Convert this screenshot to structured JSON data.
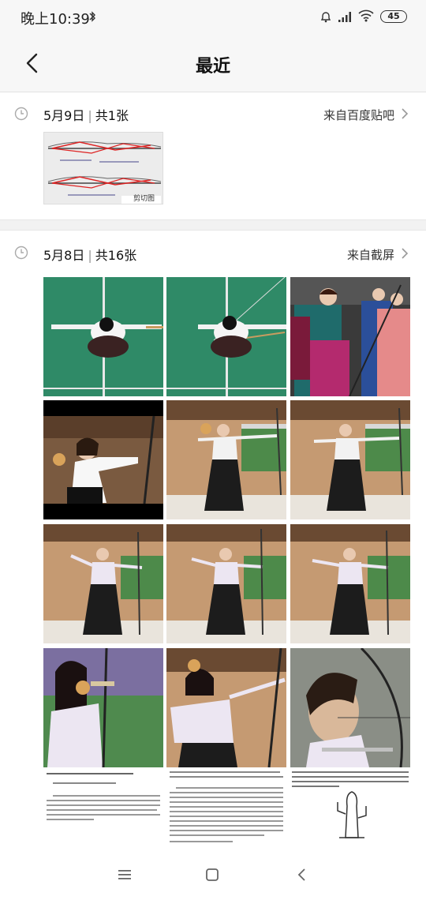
{
  "status_bar": {
    "time": "晚上10:39",
    "battery": "45",
    "icons": [
      "bluetooth-icon",
      "bell-icon",
      "signal-icon",
      "wifi-icon",
      "battery-icon"
    ]
  },
  "header": {
    "title": "最近"
  },
  "sections": [
    {
      "date": "5月9日",
      "count": "共1张",
      "source": "来自百度贴吧",
      "thumb_label": "剪切图"
    },
    {
      "date": "5月8日",
      "count": "共16张",
      "source": "来自截屏"
    }
  ],
  "nav_bar": {
    "icons": [
      "menu-icon",
      "home-icon",
      "back-nav-icon"
    ]
  },
  "colors": {
    "court_green": "#2f8a67",
    "hakama_black": "#1c1c1c",
    "wood": "#b98a5e"
  }
}
